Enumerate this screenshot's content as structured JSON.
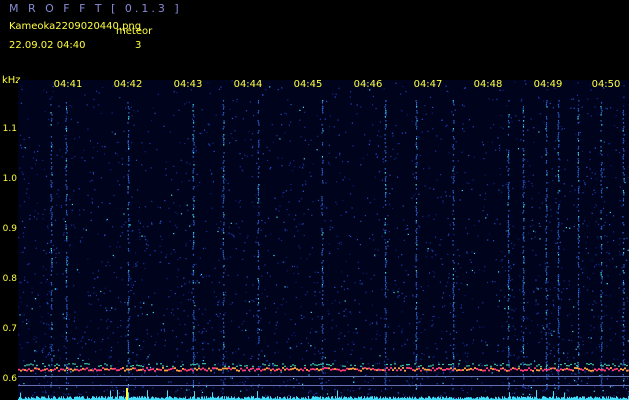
{
  "header": {
    "app_title": "M R O F F T  [ 0.1.3 ]",
    "file_name": "Kameoka2209020440.png",
    "label_meteor": "meteor",
    "datetime": "22.09.02 04:40",
    "count": "3"
  },
  "axis": {
    "y_unit": "kHz",
    "y_ticks": [
      "1.1",
      "1.0",
      "0.9",
      "0.8",
      "0.7",
      "0.6"
    ],
    "x_ticks": [
      "04:41",
      "04:42",
      "04:43",
      "04:44",
      "04:45",
      "04:46",
      "04:47",
      "04:48",
      "04:49",
      "04:50"
    ]
  },
  "colors": {
    "background": "#000000",
    "label": "#ffff40",
    "title": "#8a8ad8",
    "signal_band": "#ff3c78",
    "noise_blue": "#1e3cb4",
    "noise_cyan": "#40e0ff"
  }
}
